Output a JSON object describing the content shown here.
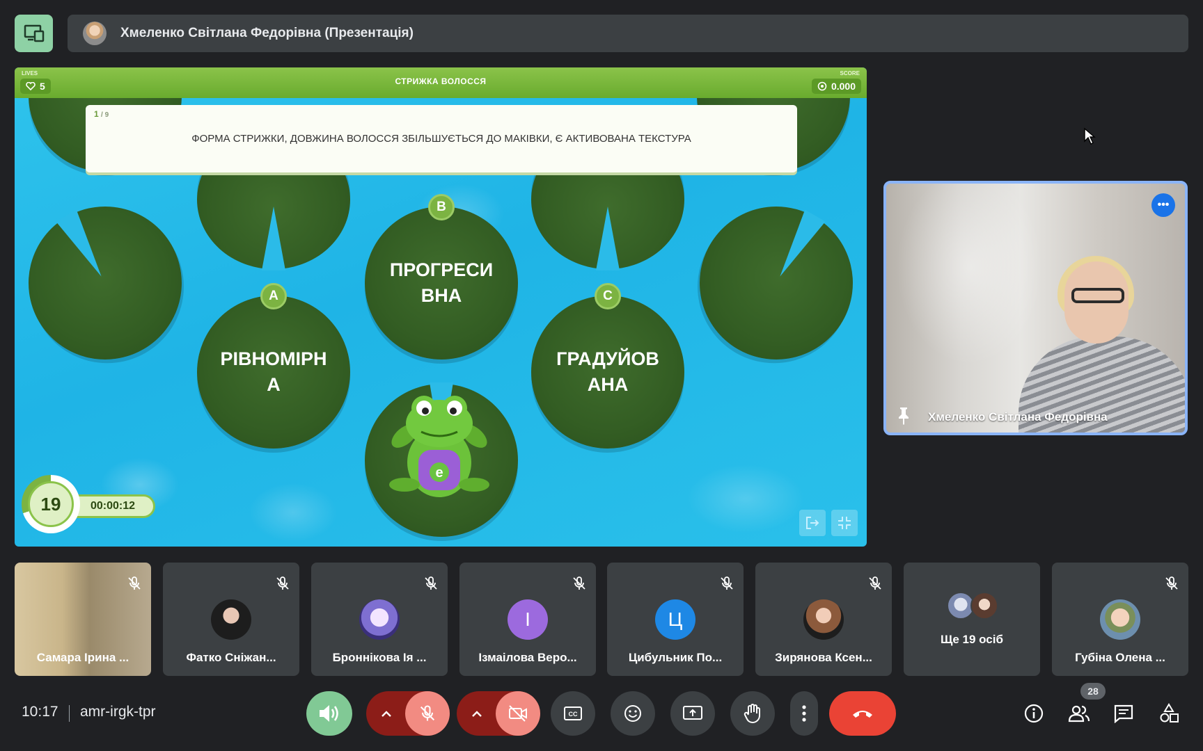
{
  "presenter": {
    "name": "Хмеленко Світлана Федорівна (Презентація)"
  },
  "game": {
    "lives_label": "LIVES",
    "lives": "5",
    "title": "СТРИЖКА ВОЛОССЯ",
    "score_label": "SCORE",
    "score": "0.000",
    "question_current": "1",
    "question_total": "/ 9",
    "question_text": "ФОРМА СТРИЖКИ, ДОВЖИНА ВОЛОССЯ ЗБІЛЬШУЄТЬСЯ ДО МАКІВКИ, Є АКТИВОВАНА ТЕКСТУРА",
    "answers": [
      {
        "letter": "A",
        "text": "РІВНОМІРН\nА"
      },
      {
        "letter": "B",
        "text": "ПРОГРЕСИ\nВНА"
      },
      {
        "letter": "C",
        "text": "ГРАДУЙОВ\nАНА"
      }
    ],
    "frog_badge": "e",
    "timer_count": "19",
    "timer_elapsed": "00:00:12"
  },
  "speaker": {
    "name": "Хмеленко Світлана Федорівна",
    "more_label": "•••"
  },
  "participants": [
    {
      "name": "Самара Ірина ...",
      "type": "video",
      "muted": true
    },
    {
      "name": "Фатко Сніжан...",
      "type": "photo",
      "muted": true,
      "color": "#5a4b4b"
    },
    {
      "name": "Броннікова Ія ...",
      "type": "photo",
      "muted": true,
      "color": "#7e6fd1"
    },
    {
      "name": "Ізмаілова Веро...",
      "type": "initial",
      "initial": "І",
      "color": "#9c6ade",
      "muted": true
    },
    {
      "name": "Цибульник По...",
      "type": "initial",
      "initial": "Ц",
      "color": "#1e88e5",
      "muted": true
    },
    {
      "name": "Зирянова Ксен...",
      "type": "photo",
      "muted": true,
      "color": "#8c5a3c"
    },
    {
      "name": "Ще 19 осіб",
      "type": "more",
      "muted": false
    },
    {
      "name": "Губіна Олена ...",
      "type": "photo",
      "muted": true,
      "color": "#6d8fae"
    }
  ],
  "bottom": {
    "time": "10:17",
    "meeting_code": "amr-irgk-tpr",
    "people_count": "28"
  },
  "colors": {
    "accent": "#8ab4f8",
    "danger": "#ea4335",
    "green": "#81c995"
  }
}
